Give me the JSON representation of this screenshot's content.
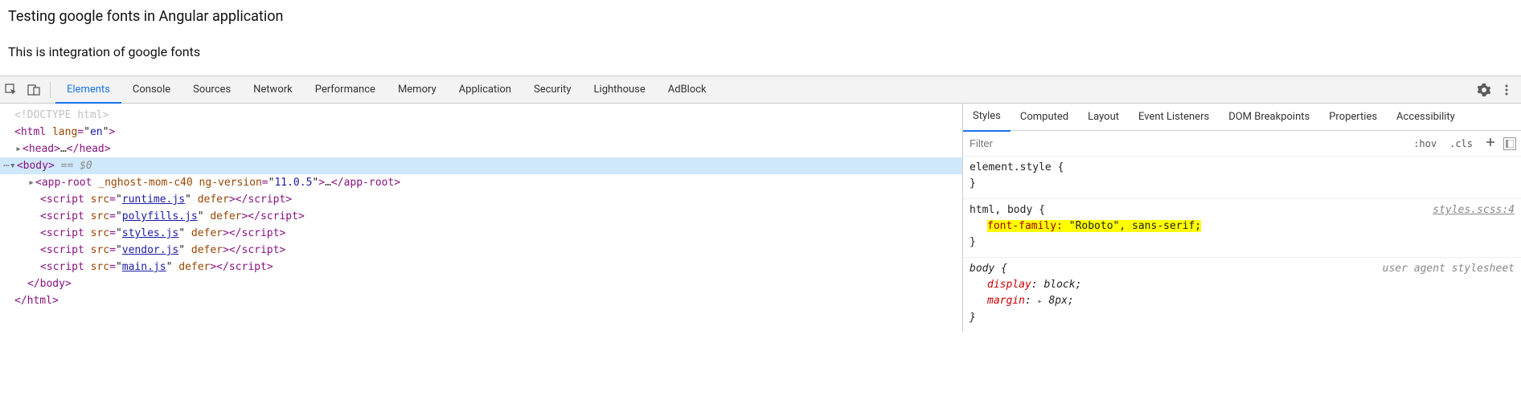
{
  "page": {
    "heading": "Testing google fonts in Angular application",
    "paragraph": "This is integration of google fonts"
  },
  "devtools": {
    "tabs": [
      "Elements",
      "Console",
      "Sources",
      "Network",
      "Performance",
      "Memory",
      "Application",
      "Security",
      "Lighthouse",
      "AdBlock"
    ],
    "active_tab": "Elements"
  },
  "elements": {
    "doctype": "<!DOCTYPE html>",
    "html_open": {
      "tag": "html",
      "attr": "lang",
      "val": "en"
    },
    "head_label": "head",
    "body_label": "body",
    "var_ref": "== $0",
    "approot": {
      "tag": "app-root",
      "a1n": "_nghost-mom-c40",
      "a2n": "ng-version",
      "a2v": "11.0.5"
    },
    "scripts": [
      {
        "src": "runtime.js",
        "defer": "defer"
      },
      {
        "src": "polyfills.js",
        "defer": "defer"
      },
      {
        "src": "styles.js",
        "defer": "defer"
      },
      {
        "src": "vendor.js",
        "defer": "defer"
      },
      {
        "src": "main.js",
        "defer": "defer"
      }
    ],
    "body_close": "</body>",
    "html_close": "</html>"
  },
  "styles": {
    "tabs": [
      "Styles",
      "Computed",
      "Layout",
      "Event Listeners",
      "DOM Breakpoints",
      "Properties",
      "Accessibility"
    ],
    "active_tab": "Styles",
    "filter_placeholder": "Filter",
    "hov": ":hov",
    "cls": ".cls",
    "rules": {
      "r0": {
        "selector": "element.style",
        "open": "{",
        "close": "}"
      },
      "r1": {
        "selector": "html, body",
        "open": "{",
        "source": "styles.scss:4",
        "prop_name": "font-family",
        "prop_val": "\"Roboto\", sans-serif",
        "close": "}"
      },
      "r2": {
        "selector": "body",
        "open": "{",
        "source": "user agent stylesheet",
        "p1n": "display",
        "p1v": "block",
        "p2n": "margin",
        "p2v": "8px",
        "close": "}"
      }
    }
  }
}
